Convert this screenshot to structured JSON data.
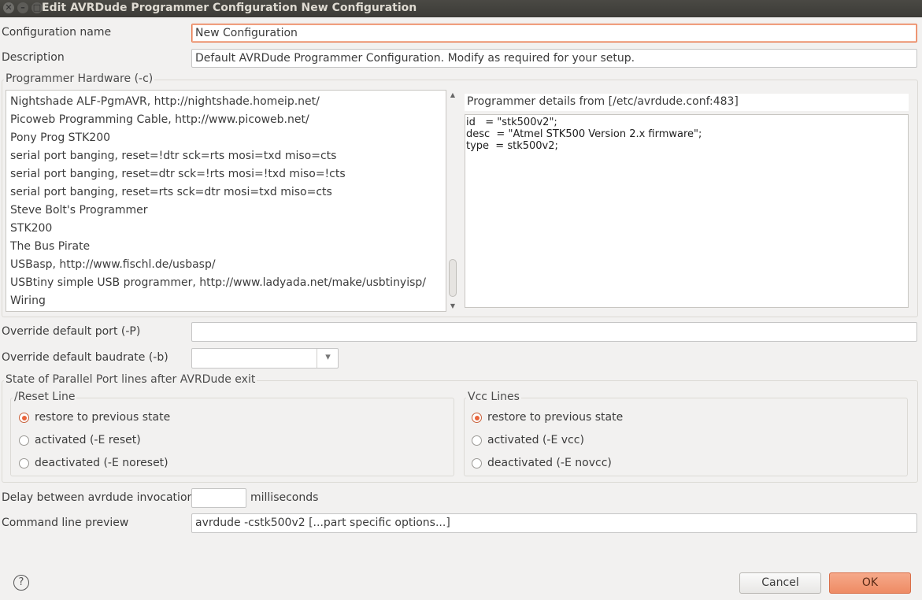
{
  "window": {
    "title": "Edit AVRDude Programmer Configuration New Configuration",
    "close_glyph": "✕",
    "minimize_glyph": "–",
    "maximize_glyph": "□"
  },
  "form": {
    "config_name_label": "Configuration name",
    "config_name_value": "New Configuration",
    "description_label": "Description",
    "description_value": "Default AVRDude Programmer Configuration. Modify as required for your setup."
  },
  "programmer_hardware": {
    "legend": "Programmer Hardware (-c)",
    "items": [
      "Nightshade ALF-PgmAVR, http://nightshade.homeip.net/",
      "Picoweb Programming Cable, http://www.picoweb.net/",
      "Pony Prog STK200",
      "serial port banging, reset=!dtr sck=rts mosi=txd miso=cts",
      "serial port banging, reset=dtr sck=!rts mosi=!txd miso=!cts",
      "serial port banging, reset=rts sck=dtr mosi=txd miso=cts",
      "Steve Bolt's Programmer",
      "STK200",
      "The Bus Pirate",
      "USBasp, http://www.fischl.de/usbasp/",
      "USBtiny simple USB programmer, http://www.ladyada.net/make/usbtinyisp/",
      "Wiring"
    ],
    "details_label": "Programmer details from [/etc/avrdude.conf:483]",
    "details_text": "id   = \"stk500v2\";\ndesc  = \"Atmel STK500 Version 2.x firmware\";\ntype  = stk500v2;"
  },
  "port": {
    "label": "Override default port (-P)",
    "value": ""
  },
  "baudrate": {
    "label": "Override default baudrate (-b)",
    "value": "",
    "dropdown_glyph": "▾"
  },
  "parallel": {
    "legend": "State of Parallel Port lines after AVRDude exit",
    "reset": {
      "legend": "/Reset Line",
      "options": [
        "restore to previous state",
        "activated (-E reset)",
        "deactivated (-E noreset)"
      ],
      "selected": 0
    },
    "vcc": {
      "legend": "Vcc Lines",
      "options": [
        "restore to previous state",
        "activated (-E vcc)",
        "deactivated (-E novcc)"
      ],
      "selected": 0
    }
  },
  "delay": {
    "label": "Delay between avrdude invocations",
    "value": "",
    "unit": "milliseconds"
  },
  "preview": {
    "label": "Command line preview",
    "value": "avrdude -cstk500v2  [...part specific options...]"
  },
  "footer": {
    "help_glyph": "?",
    "cancel_label": "Cancel",
    "ok_label": "OK"
  },
  "colors": {
    "accent": "#e9643b",
    "ok_button": "#ee8b64",
    "titlebar": "#3c3b37"
  }
}
